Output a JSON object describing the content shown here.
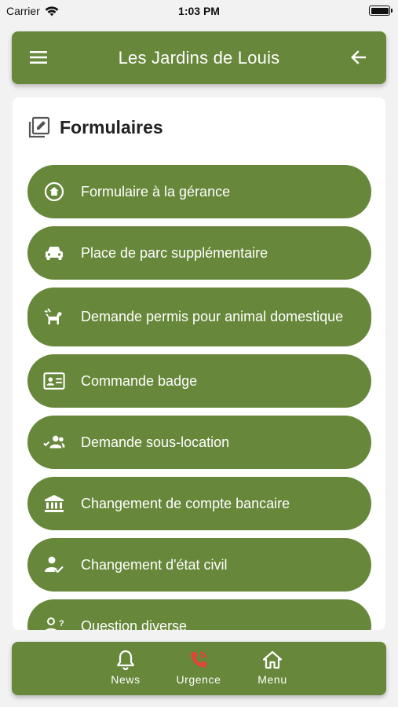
{
  "status_bar": {
    "carrier": "Carrier",
    "time": "1:03 PM"
  },
  "app_bar": {
    "title": "Les Jardins de Louis",
    "menu_icon": "hamburger-menu-icon",
    "back_icon": "arrow-back-icon"
  },
  "card": {
    "title": "Formulaires",
    "title_icon": "edit-note-icon",
    "items": [
      {
        "label": "Formulaire à la gérance",
        "icon": "home-icon"
      },
      {
        "label": "Place de parc supplémentaire",
        "icon": "car-icon"
      },
      {
        "label": "Demande permis pour animal domestique",
        "icon": "pet-icon"
      },
      {
        "label": "Commande badge",
        "icon": "id-badge-icon"
      },
      {
        "label": "Demande sous-location",
        "icon": "group-check-icon"
      },
      {
        "label": "Changement de compte bancaire",
        "icon": "bank-icon"
      },
      {
        "label": "Changement d'état civil",
        "icon": "person-check-icon"
      },
      {
        "label": "Question diverse",
        "icon": "person-question-icon"
      }
    ]
  },
  "bottom_nav": {
    "items": [
      {
        "label": "News",
        "icon": "bell-icon"
      },
      {
        "label": "Urgence",
        "icon": "emergency-phone-icon",
        "icon_color": "#e0443a"
      },
      {
        "label": "Menu",
        "icon": "home-icon"
      }
    ]
  },
  "colors": {
    "primary": "#67873a",
    "background": "#f2f2f2",
    "urgent": "#e0443a"
  }
}
